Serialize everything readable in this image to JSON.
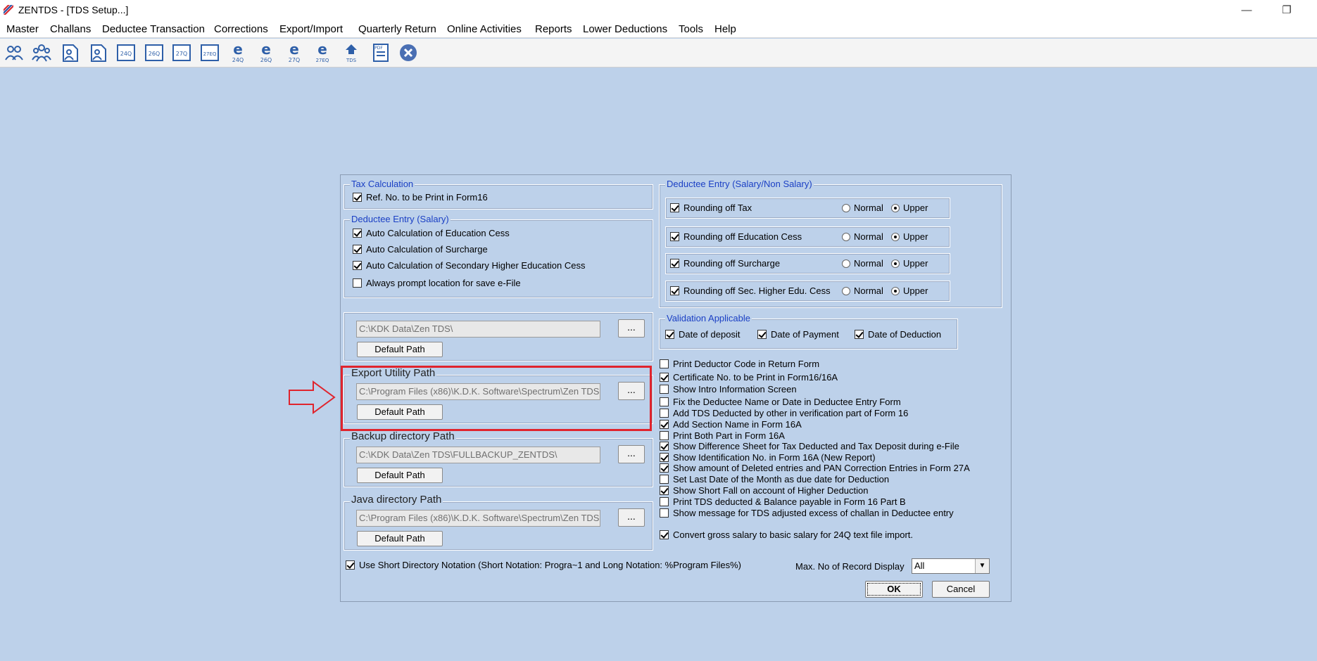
{
  "window": {
    "title": "ZENTDS - [TDS Setup...]",
    "minimize_glyph": "—",
    "restore_glyph": "❐"
  },
  "menu": [
    "Master",
    "Challans",
    "Deductee Transaction",
    "Corrections",
    "Export/Import",
    "Quarterly Return",
    "Online Activities",
    "Reports",
    "Lower Deductions",
    "Tools",
    "Help"
  ],
  "toolbar": {
    "buttons": [
      {
        "name": "deductor-icon",
        "label": ""
      },
      {
        "name": "deductee-icon",
        "label": ""
      },
      {
        "name": "user-add-icon",
        "label": ""
      },
      {
        "name": "user-edit-icon",
        "label": ""
      },
      {
        "name": "form-24q-icon",
        "label": "24Q"
      },
      {
        "name": "form-26q-icon",
        "label": "26Q"
      },
      {
        "name": "form-27q-icon",
        "label": "27Q"
      },
      {
        "name": "form-27eq-icon",
        "label": "27EQ"
      },
      {
        "name": "efile-24q-icon",
        "label": "24Q"
      },
      {
        "name": "efile-26q-icon",
        "label": "26Q"
      },
      {
        "name": "efile-27q-icon",
        "label": "27Q"
      },
      {
        "name": "efile-27eq-icon",
        "label": "27EQ"
      },
      {
        "name": "tds-icon",
        "label": "TDS"
      },
      {
        "name": "pdf-report-icon",
        "label": "PDF"
      },
      {
        "name": "close-app-icon",
        "label": ""
      }
    ]
  },
  "tax_calc": {
    "title": "Tax Calculation",
    "ref_no": {
      "label": "Ref. No. to be Print in Form16",
      "checked": true
    }
  },
  "ded_salary": {
    "title": "Deductee Entry (Salary)",
    "items": [
      {
        "label": "Auto Calculation of Education Cess",
        "checked": true
      },
      {
        "label": "Auto Calculation of Surcharge",
        "checked": true
      },
      {
        "label": "Auto Calculation of Secondary Higher Education Cess",
        "checked": true
      },
      {
        "label": "Always prompt location for save e-File",
        "checked": false
      }
    ]
  },
  "paths": {
    "data": {
      "title": "",
      "value": "C:\\KDK Data\\Zen TDS\\",
      "button": "Default Path",
      "browse": "..."
    },
    "export": {
      "title": "Export Utility Path",
      "value": "C:\\Program Files (x86)\\K.D.K. Software\\Spectrum\\Zen TDS",
      "button": "Default Path",
      "browse": "..."
    },
    "backup": {
      "title": "Backup directory Path",
      "value": "C:\\KDK Data\\Zen TDS\\FULLBACKUP_ZENTDS\\",
      "button": "Default Path",
      "browse": "..."
    },
    "java": {
      "title": "Java directory Path",
      "value": "C:\\Program Files (x86)\\K.D.K. Software\\Spectrum\\Zen TDS",
      "button": "Default Path",
      "browse": "..."
    }
  },
  "ded_all": {
    "title": "Deductee Entry (Salary/Non Salary)",
    "rounding": [
      {
        "label": "Rounding off Tax",
        "checked": true,
        "normal": "Normal",
        "upper": "Upper",
        "selected": "Upper"
      },
      {
        "label": "Rounding off Education Cess",
        "checked": true,
        "normal": "Normal",
        "upper": "Upper",
        "selected": "Upper"
      },
      {
        "label": "Rounding off Surcharge",
        "checked": true,
        "normal": "Normal",
        "upper": "Upper",
        "selected": "Upper"
      },
      {
        "label": "Rounding off Sec. Higher Edu. Cess",
        "checked": true,
        "normal": "Normal",
        "upper": "Upper",
        "selected": "Upper"
      }
    ]
  },
  "validation": {
    "title": "Validation Applicable",
    "items": [
      {
        "label": "Date of deposit",
        "checked": true
      },
      {
        "label": "Date of Payment",
        "checked": true
      },
      {
        "label": "Date of Deduction",
        "checked": true
      }
    ]
  },
  "options": [
    {
      "label": "Print Deductor Code in Return Form",
      "checked": false
    },
    {
      "label": "Certificate No. to be Print in Form16/16A",
      "checked": true
    },
    {
      "label": "Show Intro Information Screen",
      "checked": false
    },
    {
      "label": "Fix the Deductee Name or Date in Deductee Entry Form",
      "checked": false
    },
    {
      "label": "Add TDS Deducted by other in verification part of Form 16",
      "checked": false
    },
    {
      "label": "Add Section Name in Form 16A",
      "checked": true
    },
    {
      "label": "Print Both Part in Form 16A",
      "checked": false
    },
    {
      "label": "Show Difference Sheet for Tax Deducted and Tax Deposit during e-File",
      "checked": true
    },
    {
      "label": "Show Identification No. in Form 16A (New Report)",
      "checked": true
    },
    {
      "label": "Show amount of Deleted entries and PAN Correction Entries in Form 27A",
      "checked": true
    },
    {
      "label": "Set Last Date of the Month as due date for Deduction",
      "checked": false
    },
    {
      "label": "Show Short Fall on account of Higher Deduction",
      "checked": true
    },
    {
      "label": "Print TDS deducted & Balance payable in Form 16 Part B",
      "checked": false
    },
    {
      "label": "Show message for TDS adjusted excess of challan in Deductee entry",
      "checked": false
    }
  ],
  "convert_gross": {
    "label": "Convert gross salary to basic salary for 24Q text file import.",
    "checked": true
  },
  "short_notation": {
    "label": "Use Short Directory Notation (Short Notation: Progra~1 and Long Notation: %Program Files%)",
    "checked": true
  },
  "max_records": {
    "label": "Max. No of Record Display",
    "value": "All"
  },
  "buttons": {
    "ok": "OK",
    "cancel": "Cancel"
  },
  "colors": {
    "background": "#bdd1ea",
    "group_title": "#1a3fc4",
    "highlight": "#e0242d"
  }
}
